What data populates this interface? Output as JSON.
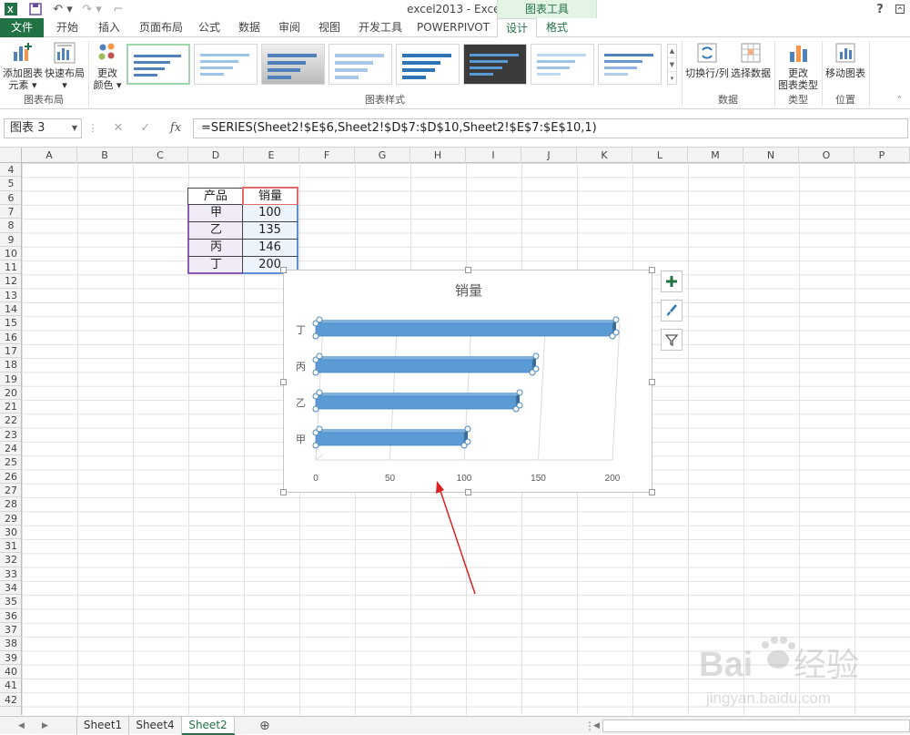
{
  "window": {
    "title": "excel2013 - Excel",
    "context_tools_label": "图表工具",
    "help_label": "?"
  },
  "tabs": [
    {
      "id": "file",
      "label": "文件"
    },
    {
      "id": "home",
      "label": "开始"
    },
    {
      "id": "insert",
      "label": "插入"
    },
    {
      "id": "layout",
      "label": "页面布局"
    },
    {
      "id": "formula",
      "label": "公式"
    },
    {
      "id": "data",
      "label": "数据"
    },
    {
      "id": "review",
      "label": "审阅"
    },
    {
      "id": "view",
      "label": "视图"
    },
    {
      "id": "dev",
      "label": "开发工具"
    },
    {
      "id": "powerpivot",
      "label": "POWERPIVOT"
    },
    {
      "id": "design",
      "label": "设计"
    },
    {
      "id": "format",
      "label": "格式"
    }
  ],
  "ribbon": {
    "add_element_line1": "添加图表",
    "add_element_line2": "元素 ▾",
    "quick_layout_line1": "快速布局",
    "quick_layout_line2": "▾",
    "change_color_line1": "更改",
    "change_color_line2": "颜色 ▾",
    "switch_row_col": "切换行/列",
    "select_data": "选择数据",
    "change_type_line1": "更改",
    "change_type_line2": "图表类型",
    "move_chart": "移动图表",
    "group_layouts": "图表布局",
    "group_styles": "图表样式",
    "group_data": "数据",
    "group_type": "类型",
    "group_location": "位置"
  },
  "formula_bar": {
    "name_box": "图表 3",
    "formula": "=SERIES(Sheet2!$E$6,Sheet2!$D$7:$D$10,Sheet2!$E$7:$E$10,1)",
    "fx_label": "fx",
    "cancel_glyph": "✕",
    "enter_glyph": "✓"
  },
  "columns": [
    "A",
    "B",
    "C",
    "D",
    "E",
    "F",
    "G",
    "H",
    "I",
    "J",
    "K",
    "L",
    "M",
    "N",
    "O",
    "P"
  ],
  "rows": [
    "4",
    "5",
    "6",
    "7",
    "8",
    "9",
    "10",
    "11",
    "12",
    "13",
    "14",
    "15",
    "16",
    "17",
    "18",
    "19",
    "20",
    "21",
    "22",
    "23",
    "24",
    "25",
    "26",
    "27",
    "28",
    "29",
    "30",
    "31",
    "32",
    "33",
    "34",
    "35",
    "36",
    "37",
    "38",
    "39",
    "40",
    "41",
    "42"
  ],
  "table": {
    "header": [
      "产品",
      "销量"
    ],
    "rows": [
      [
        "甲",
        "100"
      ],
      [
        "乙",
        "135"
      ],
      [
        "丙",
        "146"
      ],
      [
        "丁",
        "200"
      ]
    ]
  },
  "chart_data": {
    "type": "bar",
    "title": "销量",
    "orientation": "horizontal",
    "categories": [
      "甲",
      "乙",
      "丙",
      "丁"
    ],
    "series": [
      {
        "values": [
          100,
          135,
          146,
          200
        ]
      }
    ],
    "xlim": [
      0,
      200
    ],
    "xticks": [
      "0",
      "50",
      "100",
      "150",
      "200"
    ],
    "grid": true,
    "style": "3d-clustered-bar",
    "bar_color": "#5b9bd5"
  },
  "sheets": {
    "tabs": [
      "Sheet1",
      "Sheet4",
      "Sheet2"
    ],
    "active": "Sheet2",
    "add_glyph": "⊕"
  },
  "watermark": {
    "brand": "Bai",
    "brand_suffix": "经验",
    "url": "jingyan.baidu.com"
  },
  "colors": {
    "excel_green": "#217346",
    "annotation_arrow": "#e02020"
  }
}
